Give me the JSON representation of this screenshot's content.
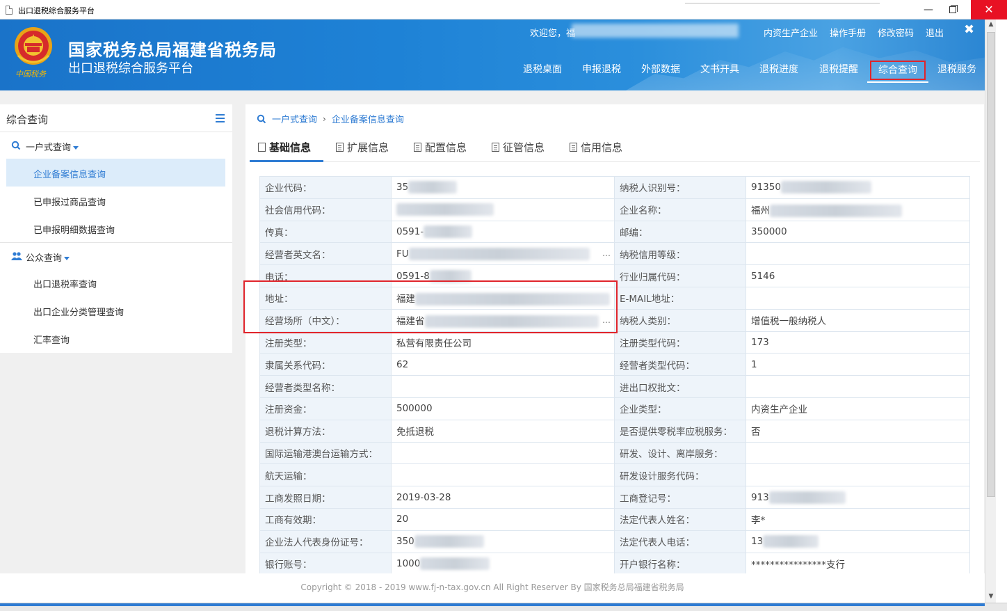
{
  "window": {
    "title": "出口退税综合服务平台"
  },
  "header": {
    "org_name": "国家税务总局福建省税务局",
    "platform_name": "出口退税综合服务平台",
    "emblem_text": "中国税务",
    "welcome": "欢迎您，福",
    "top_links": [
      "内资生产企业",
      "操作手册",
      "修改密码",
      "退出"
    ],
    "nav": [
      "退税桌面",
      "申报退税",
      "外部数据",
      "文书开具",
      "退税进度",
      "退税提醒",
      "综合查询",
      "退税服务"
    ],
    "active_nav": "综合查询"
  },
  "sidebar": {
    "title": "综合查询",
    "groups": [
      {
        "label": "一户式查询",
        "icon": "search-icon",
        "items": [
          "企业备案信息查询",
          "已申报过商品查询",
          "已申报明细数据查询"
        ]
      },
      {
        "label": "公众查询",
        "icon": "users-icon",
        "items": [
          "出口退税率查询",
          "出口企业分类管理查询",
          "汇率查询"
        ]
      }
    ],
    "active_item": "企业备案信息查询"
  },
  "breadcrumb": {
    "root": "一户式查询",
    "current": "企业备案信息查询"
  },
  "tabs": [
    "基础信息",
    "扩展信息",
    "配置信息",
    "征管信息",
    "信用信息"
  ],
  "active_tab": "基础信息",
  "rows": [
    [
      "企业代码：",
      "35",
      "纳税人识别号：",
      "91350"
    ],
    [
      "社会信用代码：",
      "",
      "企业名称：",
      "福州"
    ],
    [
      "传真：",
      "0591-",
      "邮编：",
      "350000"
    ],
    [
      "经营者英文名：",
      "FU",
      "纳税信用等级：",
      ""
    ],
    [
      "电话：",
      "0591-8",
      "行业归属代码：",
      "5146"
    ],
    [
      "地址：",
      "福建",
      "E-MAIL地址：",
      ""
    ],
    [
      "经营场所（中文）：",
      "福建省",
      "纳税人类别：",
      "增值税一般纳税人"
    ],
    [
      "注册类型：",
      "私营有限责任公司",
      "注册类型代码：",
      "173"
    ],
    [
      "隶属关系代码：",
      "62",
      "经营者类型代码：",
      "1"
    ],
    [
      "经营者类型名称：",
      "",
      "进出口权批文：",
      ""
    ],
    [
      "注册资金：",
      "500000",
      "企业类型：",
      "内资生产企业"
    ],
    [
      "退税计算方法：",
      "免抵退税",
      "是否提供零税率应税服务：",
      "否"
    ],
    [
      "国际运输港澳台运输方式：",
      "",
      "研发、设计、离岸服务：",
      ""
    ],
    [
      "航天运输：",
      "",
      "研发设计服务代码：",
      ""
    ],
    [
      "工商发照日期：",
      "2019-03-28",
      "工商登记号：",
      "913"
    ],
    [
      "工商有效期：",
      "20",
      "法定代表人姓名：",
      "李*"
    ],
    [
      "企业法人代表身份证号：",
      "350",
      "法定代表人电话：",
      "13"
    ],
    [
      "银行账号：",
      "1000",
      "开户银行名称：",
      "****************支行"
    ]
  ],
  "footer": "Copyright © 2018 - 2019 www.fj-n-tax.gov.cn All Right Reserver By 国家税务总局福建省税务局",
  "colors": {
    "header_blue": "#1e82d6",
    "accent": "#2f7cd3",
    "highlight": "#e0242b"
  }
}
